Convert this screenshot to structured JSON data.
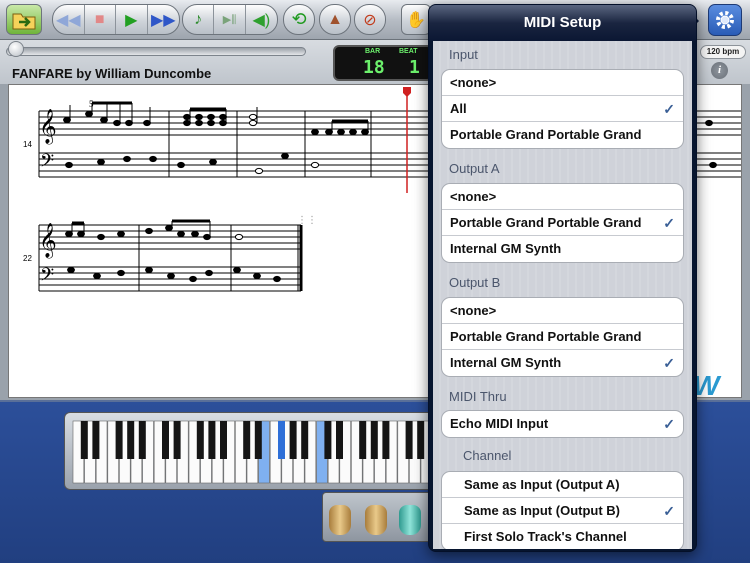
{
  "toolbar": {
    "open_icon": "folder-open-icon",
    "rewind_icon": "rewind-icon",
    "stop_icon": "stop-icon",
    "play_icon": "play-icon",
    "forward_icon": "fast-forward-icon",
    "note_icon": "music-note-icon",
    "keys_icon": "piano-keys-icon",
    "volume_icon": "speaker-volume-icon",
    "loop_icon": "loop-icon",
    "metronome_icon": "metronome-icon",
    "mute_icon": "mute-icon",
    "hand_icon": "hand-icon",
    "settings_icon": "gear-icon"
  },
  "song": {
    "title": "FANFARE by William Duncombe"
  },
  "counter": {
    "bar_label": "BAR",
    "beat_label": "BEAT",
    "bar_value": "18",
    "beat_value": "1"
  },
  "tempo": {
    "bpm_label": "120 bpm",
    "info_label": "i"
  },
  "score": {
    "measure_14": "14",
    "measure_22": "22",
    "fingering": "5"
  },
  "midi_setup": {
    "title": "MIDI Setup",
    "sections": [
      {
        "header": "Input",
        "items": [
          {
            "label": "<none>",
            "checked": false
          },
          {
            "label": "All",
            "checked": true
          },
          {
            "label": "Portable Grand Portable Grand",
            "checked": false
          }
        ]
      },
      {
        "header": "Output A",
        "items": [
          {
            "label": "<none>",
            "checked": false
          },
          {
            "label": "Portable Grand Portable Grand",
            "checked": true
          },
          {
            "label": "Internal GM Synth",
            "checked": false
          }
        ]
      },
      {
        "header": "Output B",
        "items": [
          {
            "label": "<none>",
            "checked": false
          },
          {
            "label": "Portable Grand Portable Grand",
            "checked": false
          },
          {
            "label": "Internal GM Synth",
            "checked": true
          }
        ]
      },
      {
        "header": "MIDI Thru",
        "items": [
          {
            "label": "Echo MIDI Input",
            "checked": true
          }
        ]
      },
      {
        "header": "Channel",
        "items": [
          {
            "label": "Same as Input (Output A)",
            "checked": false
          },
          {
            "label": "Same as Input (Output B)",
            "checked": true
          },
          {
            "label": "First Solo Track's Channel",
            "checked": false
          }
        ]
      }
    ],
    "check_glyph": "✓"
  },
  "colors": {
    "accent": "#3a5f96",
    "counter_green": "#6cf06c",
    "playhead": "#d02020",
    "key_highlight": "#2e6fd8",
    "keyboard_bg": "#213f80"
  }
}
